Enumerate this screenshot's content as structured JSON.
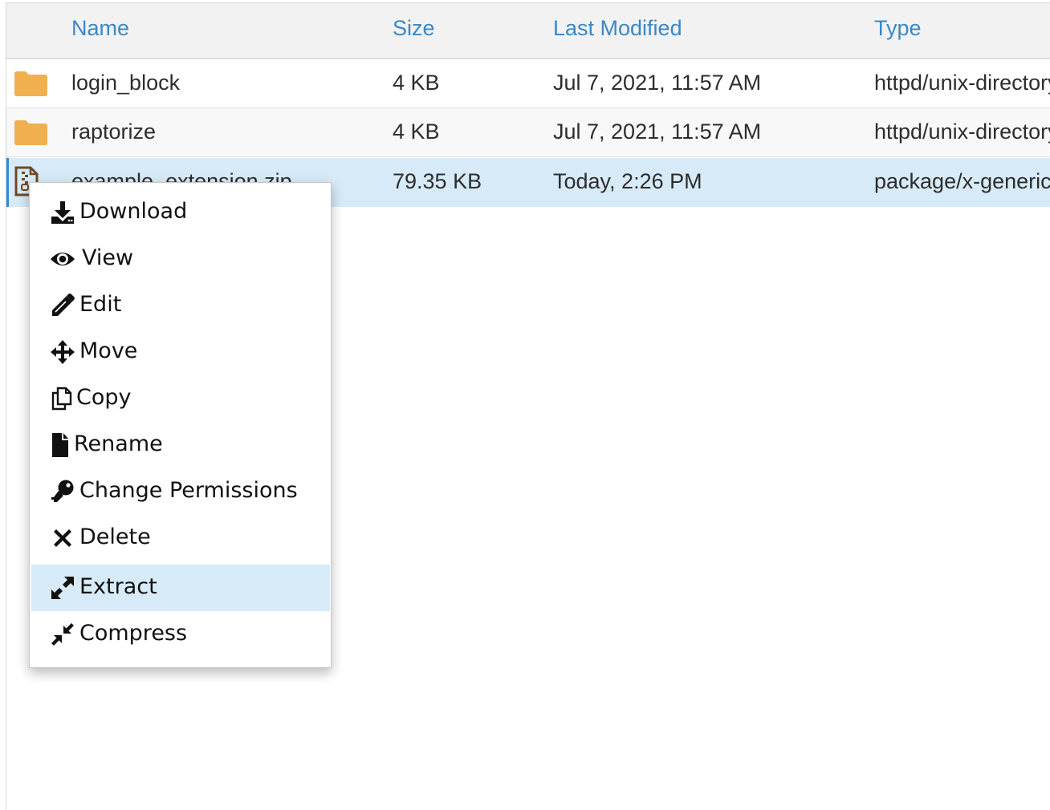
{
  "columns": {
    "name": "Name",
    "size": "Size",
    "modified": "Last Modified",
    "type": "Type"
  },
  "rows": [
    {
      "icon": "folder-icon",
      "name": "login_block",
      "size": "4 KB",
      "modified": "Jul 7, 2021, 11:57 AM",
      "type": "httpd/unix-directory",
      "selected": false
    },
    {
      "icon": "folder-icon",
      "name": "raptorize",
      "size": "4 KB",
      "modified": "Jul 7, 2021, 11:57 AM",
      "type": "httpd/unix-directory",
      "selected": false
    },
    {
      "icon": "zip-file-icon",
      "name": "example_extension.zip",
      "size": "79.35 KB",
      "modified": "Today, 2:26 PM",
      "type": "package/x-generic",
      "selected": true
    }
  ],
  "context_menu": {
    "items": [
      {
        "label": "Download",
        "icon": "download-icon"
      },
      {
        "label": "View",
        "icon": "eye-icon"
      },
      {
        "label": "Edit",
        "icon": "pencil-icon"
      },
      {
        "label": "Move",
        "icon": "move-arrows-icon"
      },
      {
        "label": "Copy",
        "icon": "copy-icon"
      },
      {
        "label": "Rename",
        "icon": "file-icon"
      },
      {
        "label": "Change Permissions",
        "icon": "key-icon"
      },
      {
        "label": "Delete",
        "icon": "x-icon"
      },
      {
        "label": "Extract",
        "icon": "expand-icon",
        "highlighted": true
      },
      {
        "label": "Compress",
        "icon": "compress-icon"
      }
    ]
  },
  "colors": {
    "header_text": "#3a88c8",
    "folder": "#f0b04f",
    "selection": "#d7eaf7",
    "selection_bar": "#2b8bd6"
  }
}
